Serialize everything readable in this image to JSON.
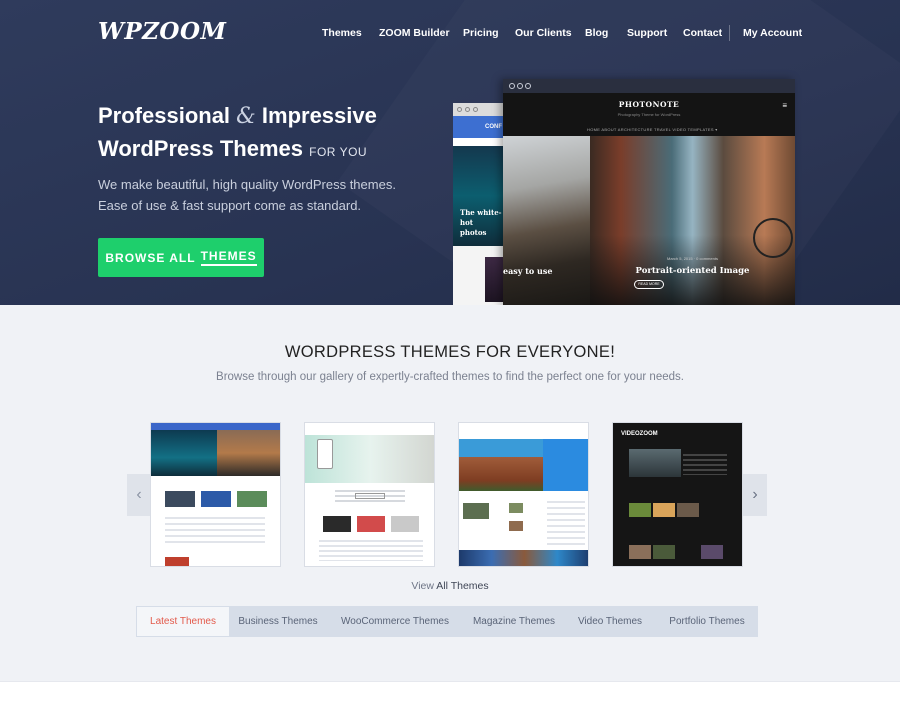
{
  "header": {
    "logo": "WPZOOM",
    "nav": [
      "Themes",
      "ZOOM Builder",
      "Pricing",
      "Our Clients",
      "Blog",
      "Support",
      "Contact",
      "My Account"
    ]
  },
  "hero": {
    "headline_part1": "Professional",
    "headline_amp": "&",
    "headline_part2": "Impressive",
    "headline_line2": "WordPress Themes",
    "headline_small": "FOR YOU",
    "subtitle_line1": "We make beautiful, high quality WordPress themes.",
    "subtitle_line2": "Ease of use & fast support come as standard.",
    "cta_prefix": "BROWSE ALL",
    "cta_highlight": "THEMES"
  },
  "mockup": {
    "back_header": "CONF",
    "back_caption_l1": "The white-hot",
    "back_caption_l2": "photos",
    "front_title": "PHOTONOTE",
    "front_tagline": "Photography Theme for WordPress",
    "front_nav": "HOME    ABOUT    ARCHITECTURE    TRAVEL    VIDEO    TEMPLATES ▾",
    "slide1_caption": "easy to use",
    "slide2_caption": "Portrait-oriented Image",
    "slide2_date": "March 5, 2015  ·  0 comments",
    "slide2_button": "READ MORE"
  },
  "themes_section": {
    "title": "WORDPRESS THEMES FOR EVERYONE!",
    "subtitle": "Browse through our gallery of expertly-crafted themes to find the perfect one for your needs.",
    "view_all_prefix": "View",
    "view_all_link": "All Themes",
    "card4_logo": "VIDEOZOOM"
  },
  "tabs": [
    "Latest Themes",
    "Business Themes",
    "WooCommerce Themes",
    "Magazine Themes",
    "Video Themes",
    "Portfolio Themes"
  ],
  "colors": {
    "hero_bg": "#2b3656",
    "cta_green": "#1ecf6c",
    "active_tab_text": "#e35a4b",
    "section_bg": "#f0f2f6"
  },
  "icons": {
    "prev": "chevron-left-icon",
    "next": "chevron-right-icon",
    "menu": "hamburger-icon"
  }
}
